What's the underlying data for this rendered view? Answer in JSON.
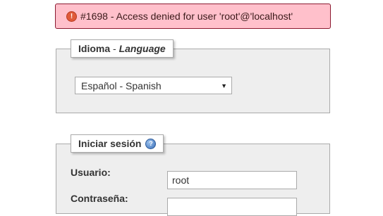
{
  "error": {
    "icon": "alert-icon",
    "icon_glyph": "!",
    "message": "#1698 - Access denied for user 'root'@'localhost'"
  },
  "language": {
    "legend_main": "Idioma",
    "legend_sep": " - ",
    "legend_italic": "Language",
    "selected": "Español - Spanish"
  },
  "login": {
    "legend": "Iniciar sesión",
    "help_icon": "help-icon",
    "help_glyph": "?",
    "username_label": "Usuario:",
    "username_value": "root",
    "password_label": "Contraseña:",
    "password_value": ""
  }
}
